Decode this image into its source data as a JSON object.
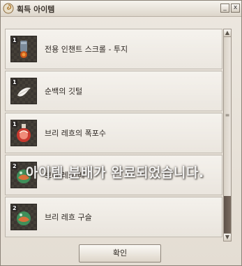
{
  "window": {
    "title": "획득 아이템",
    "minimize_label": "_",
    "close_label": "x",
    "confirm_label": "확인"
  },
  "notification": "아이템 분배가 완료되었습니다.",
  "items": [
    {
      "quantity": "1",
      "name": "전용 인챈트 스크롤 - 투지",
      "icon": "scroll-icon"
    },
    {
      "quantity": "1",
      "name": "순백의 깃털",
      "icon": "feather-icon"
    },
    {
      "quantity": "1",
      "name": "브리 레흐의 폭포수",
      "icon": "potion-icon"
    },
    {
      "quantity": "2",
      "name": "브리 레흐 배",
      "icon": "orb-icon"
    },
    {
      "quantity": "2",
      "name": "브리 레흐 구슬",
      "icon": "orb-icon"
    }
  ],
  "scrollbar": {
    "up_arrow": "▲",
    "down_arrow": "▼",
    "grip": "≡"
  }
}
